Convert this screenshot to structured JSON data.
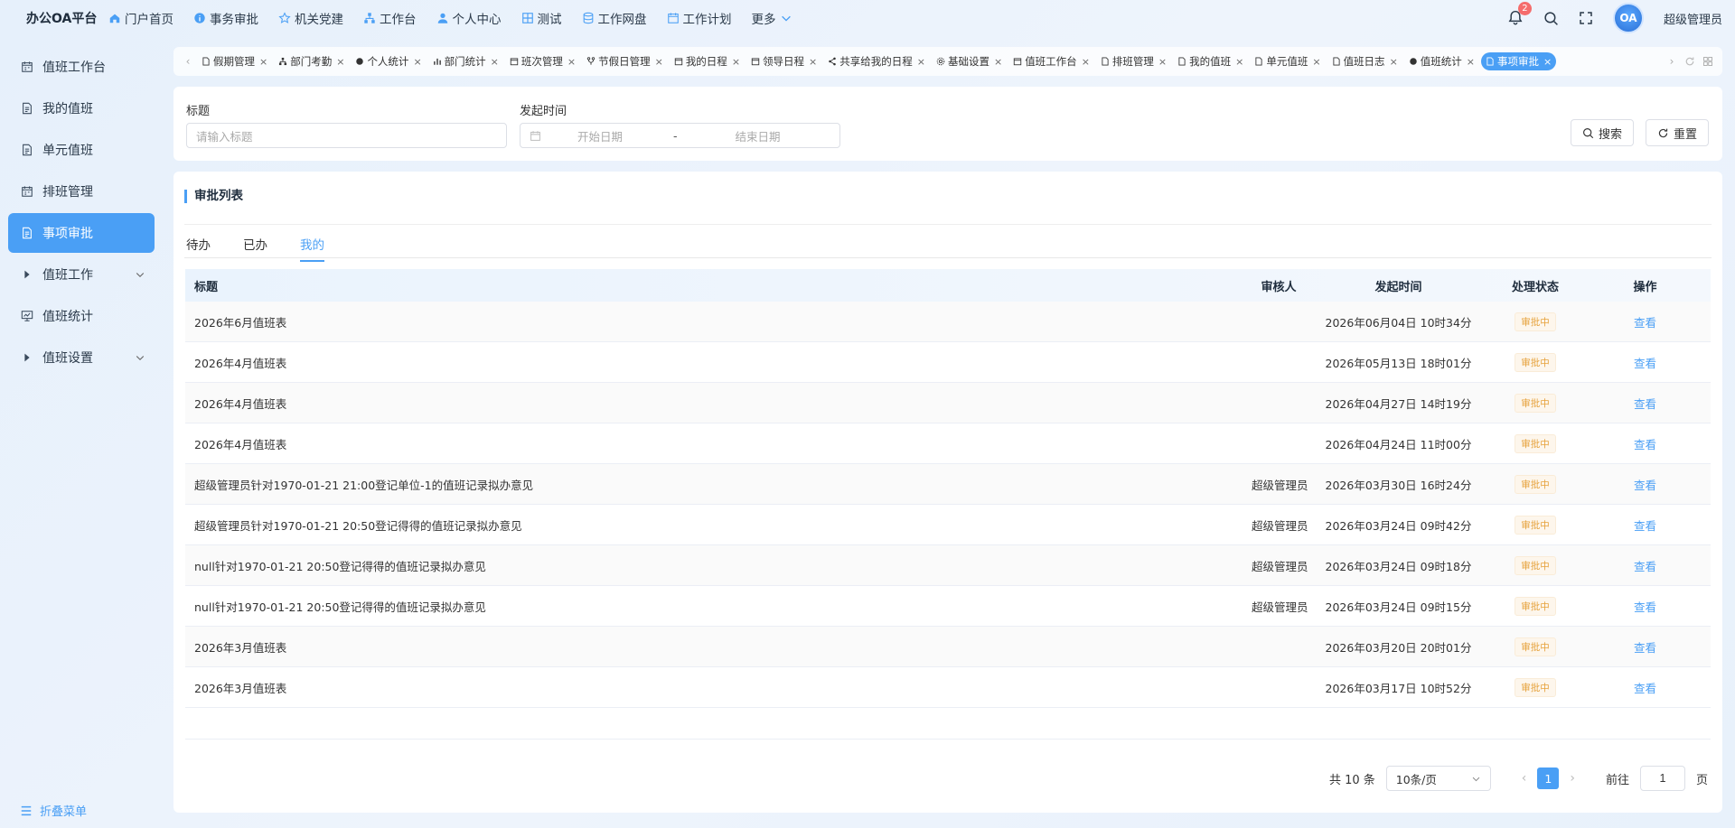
{
  "header": {
    "brand": "办公OA平台",
    "nav": [
      {
        "label": "门户首页",
        "icon": "home-icon"
      },
      {
        "label": "事务审批",
        "icon": "info-icon"
      },
      {
        "label": "机关党建",
        "icon": "star-icon"
      },
      {
        "label": "工作台",
        "icon": "sitemap-icon"
      },
      {
        "label": "个人中心",
        "icon": "user-icon"
      },
      {
        "label": "测试",
        "icon": "grid-icon"
      },
      {
        "label": "工作网盘",
        "icon": "database-icon"
      },
      {
        "label": "工作计划",
        "icon": "calendar-icon"
      },
      {
        "label": "更多",
        "icon": "chevron-down-icon"
      }
    ],
    "notification_count": "2",
    "avatar_text": "OA",
    "username": "超级管理员"
  },
  "sidebar": {
    "items": [
      {
        "label": "值班工作台",
        "icon": "calendar-icon"
      },
      {
        "label": "我的值班",
        "icon": "document-icon"
      },
      {
        "label": "单元值班",
        "icon": "document-icon"
      },
      {
        "label": "排班管理",
        "icon": "calendar-icon"
      },
      {
        "label": "事项审批",
        "icon": "document-icon",
        "active": true
      },
      {
        "label": "值班工作",
        "icon": "caret-right-icon",
        "expandable": true
      },
      {
        "label": "值班统计",
        "icon": "chart-icon"
      },
      {
        "label": "值班设置",
        "icon": "caret-right-icon",
        "expandable": true
      }
    ],
    "collapse_label": "折叠菜单"
  },
  "tabs": [
    "假期管理",
    "部门考勤",
    "个人统计",
    "部门统计",
    "班次管理",
    "节假日管理",
    "我的日程",
    "领导日程",
    "共享给我的日程",
    "基础设置",
    "值班工作台",
    "排班管理",
    "我的值班",
    "单元值班",
    "值班日志",
    "值班统计",
    "事项审批"
  ],
  "active_tab": "事项审批",
  "search": {
    "title_label": "标题",
    "title_placeholder": "请输入标题",
    "time_label": "发起时间",
    "start_placeholder": "开始日期",
    "range_sep": "-",
    "end_placeholder": "结束日期",
    "search_button": "搜索",
    "reset_button": "重置"
  },
  "list": {
    "title": "审批列表",
    "subtabs": [
      "待办",
      "已办",
      "我的"
    ],
    "active_subtab": "我的",
    "columns": {
      "title": "标题",
      "reviewer": "审核人",
      "time": "发起时间",
      "status": "处理状态",
      "op": "操作"
    },
    "rows": [
      {
        "title": "2026年6月值班表",
        "reviewer": "",
        "time": "2026年06月04日 10时34分",
        "status": "审批中",
        "op": "查看"
      },
      {
        "title": "2026年4月值班表",
        "reviewer": "",
        "time": "2026年05月13日 18时01分",
        "status": "审批中",
        "op": "查看"
      },
      {
        "title": "2026年4月值班表",
        "reviewer": "",
        "time": "2026年04月27日 14时19分",
        "status": "审批中",
        "op": "查看"
      },
      {
        "title": "2026年4月值班表",
        "reviewer": "",
        "time": "2026年04月24日 11时00分",
        "status": "审批中",
        "op": "查看"
      },
      {
        "title": "超级管理员针对1970-01-21 21:00登记单位-1的值班记录拟办意见",
        "reviewer": "超级管理员",
        "time": "2026年03月30日 16时24分",
        "status": "审批中",
        "op": "查看"
      },
      {
        "title": "超级管理员针对1970-01-21 20:50登记得得的值班记录拟办意见",
        "reviewer": "超级管理员",
        "time": "2026年03月24日 09时42分",
        "status": "审批中",
        "op": "查看"
      },
      {
        "title": "null针对1970-01-21 20:50登记得得的值班记录拟办意见",
        "reviewer": "超级管理员",
        "time": "2026年03月24日 09时18分",
        "status": "审批中",
        "op": "查看"
      },
      {
        "title": "null针对1970-01-21 20:50登记得得的值班记录拟办意见",
        "reviewer": "超级管理员",
        "time": "2026年03月24日 09时15分",
        "status": "审批中",
        "op": "查看"
      },
      {
        "title": "2026年3月值班表",
        "reviewer": "",
        "time": "2026年03月20日 20时01分",
        "status": "审批中",
        "op": "查看"
      },
      {
        "title": "2026年3月值班表",
        "reviewer": "",
        "time": "2026年03月17日 10时52分",
        "status": "审批中",
        "op": "查看"
      }
    ]
  },
  "pagination": {
    "total_text": "共 10 条",
    "page_size": "10条/页",
    "current_page": "1",
    "goto_label": "前往",
    "goto_value": "1",
    "page_suffix": "页"
  }
}
